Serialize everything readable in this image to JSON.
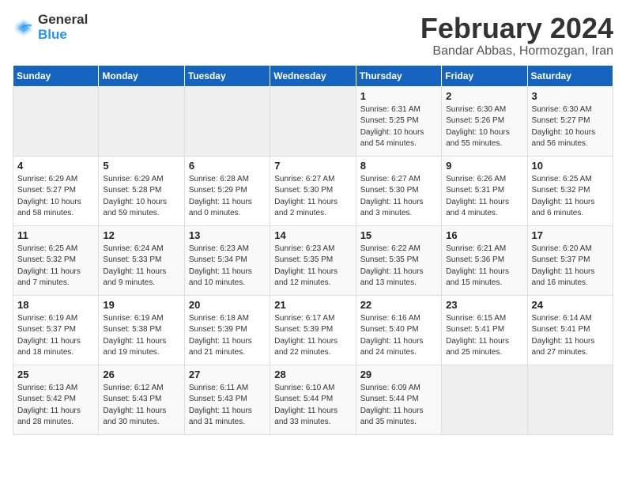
{
  "header": {
    "logo_general": "General",
    "logo_blue": "Blue",
    "month_title": "February 2024",
    "location": "Bandar Abbas, Hormozgan, Iran"
  },
  "days_of_week": [
    "Sunday",
    "Monday",
    "Tuesday",
    "Wednesday",
    "Thursday",
    "Friday",
    "Saturday"
  ],
  "weeks": [
    [
      {
        "day": "",
        "info": ""
      },
      {
        "day": "",
        "info": ""
      },
      {
        "day": "",
        "info": ""
      },
      {
        "day": "",
        "info": ""
      },
      {
        "day": "1",
        "info": "Sunrise: 6:31 AM\nSunset: 5:25 PM\nDaylight: 10 hours\nand 54 minutes."
      },
      {
        "day": "2",
        "info": "Sunrise: 6:30 AM\nSunset: 5:26 PM\nDaylight: 10 hours\nand 55 minutes."
      },
      {
        "day": "3",
        "info": "Sunrise: 6:30 AM\nSunset: 5:27 PM\nDaylight: 10 hours\nand 56 minutes."
      }
    ],
    [
      {
        "day": "4",
        "info": "Sunrise: 6:29 AM\nSunset: 5:27 PM\nDaylight: 10 hours\nand 58 minutes."
      },
      {
        "day": "5",
        "info": "Sunrise: 6:29 AM\nSunset: 5:28 PM\nDaylight: 10 hours\nand 59 minutes."
      },
      {
        "day": "6",
        "info": "Sunrise: 6:28 AM\nSunset: 5:29 PM\nDaylight: 11 hours\nand 0 minutes."
      },
      {
        "day": "7",
        "info": "Sunrise: 6:27 AM\nSunset: 5:30 PM\nDaylight: 11 hours\nand 2 minutes."
      },
      {
        "day": "8",
        "info": "Sunrise: 6:27 AM\nSunset: 5:30 PM\nDaylight: 11 hours\nand 3 minutes."
      },
      {
        "day": "9",
        "info": "Sunrise: 6:26 AM\nSunset: 5:31 PM\nDaylight: 11 hours\nand 4 minutes."
      },
      {
        "day": "10",
        "info": "Sunrise: 6:25 AM\nSunset: 5:32 PM\nDaylight: 11 hours\nand 6 minutes."
      }
    ],
    [
      {
        "day": "11",
        "info": "Sunrise: 6:25 AM\nSunset: 5:32 PM\nDaylight: 11 hours\nand 7 minutes."
      },
      {
        "day": "12",
        "info": "Sunrise: 6:24 AM\nSunset: 5:33 PM\nDaylight: 11 hours\nand 9 minutes."
      },
      {
        "day": "13",
        "info": "Sunrise: 6:23 AM\nSunset: 5:34 PM\nDaylight: 11 hours\nand 10 minutes."
      },
      {
        "day": "14",
        "info": "Sunrise: 6:23 AM\nSunset: 5:35 PM\nDaylight: 11 hours\nand 12 minutes."
      },
      {
        "day": "15",
        "info": "Sunrise: 6:22 AM\nSunset: 5:35 PM\nDaylight: 11 hours\nand 13 minutes."
      },
      {
        "day": "16",
        "info": "Sunrise: 6:21 AM\nSunset: 5:36 PM\nDaylight: 11 hours\nand 15 minutes."
      },
      {
        "day": "17",
        "info": "Sunrise: 6:20 AM\nSunset: 5:37 PM\nDaylight: 11 hours\nand 16 minutes."
      }
    ],
    [
      {
        "day": "18",
        "info": "Sunrise: 6:19 AM\nSunset: 5:37 PM\nDaylight: 11 hours\nand 18 minutes."
      },
      {
        "day": "19",
        "info": "Sunrise: 6:19 AM\nSunset: 5:38 PM\nDaylight: 11 hours\nand 19 minutes."
      },
      {
        "day": "20",
        "info": "Sunrise: 6:18 AM\nSunset: 5:39 PM\nDaylight: 11 hours\nand 21 minutes."
      },
      {
        "day": "21",
        "info": "Sunrise: 6:17 AM\nSunset: 5:39 PM\nDaylight: 11 hours\nand 22 minutes."
      },
      {
        "day": "22",
        "info": "Sunrise: 6:16 AM\nSunset: 5:40 PM\nDaylight: 11 hours\nand 24 minutes."
      },
      {
        "day": "23",
        "info": "Sunrise: 6:15 AM\nSunset: 5:41 PM\nDaylight: 11 hours\nand 25 minutes."
      },
      {
        "day": "24",
        "info": "Sunrise: 6:14 AM\nSunset: 5:41 PM\nDaylight: 11 hours\nand 27 minutes."
      }
    ],
    [
      {
        "day": "25",
        "info": "Sunrise: 6:13 AM\nSunset: 5:42 PM\nDaylight: 11 hours\nand 28 minutes."
      },
      {
        "day": "26",
        "info": "Sunrise: 6:12 AM\nSunset: 5:43 PM\nDaylight: 11 hours\nand 30 minutes."
      },
      {
        "day": "27",
        "info": "Sunrise: 6:11 AM\nSunset: 5:43 PM\nDaylight: 11 hours\nand 31 minutes."
      },
      {
        "day": "28",
        "info": "Sunrise: 6:10 AM\nSunset: 5:44 PM\nDaylight: 11 hours\nand 33 minutes."
      },
      {
        "day": "29",
        "info": "Sunrise: 6:09 AM\nSunset: 5:44 PM\nDaylight: 11 hours\nand 35 minutes."
      },
      {
        "day": "",
        "info": ""
      },
      {
        "day": "",
        "info": ""
      }
    ]
  ]
}
